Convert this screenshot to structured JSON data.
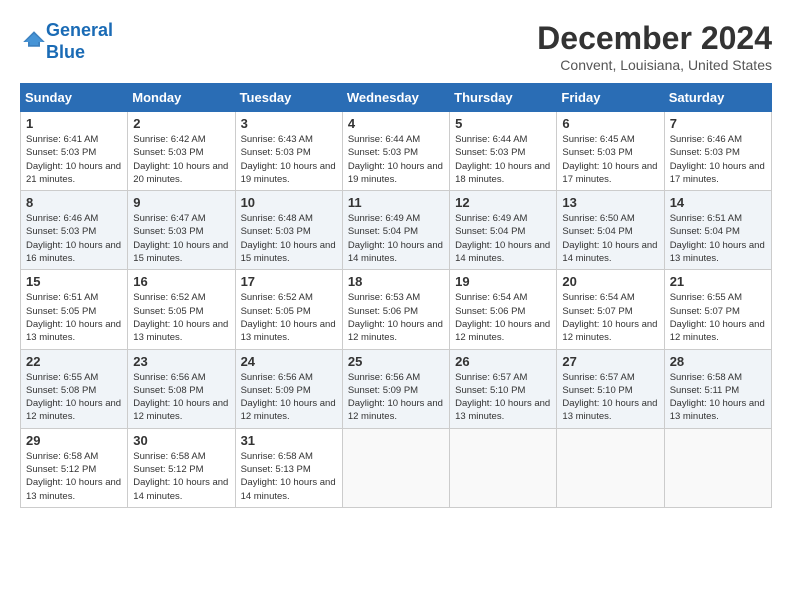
{
  "header": {
    "logo_line1": "General",
    "logo_line2": "Blue",
    "title": "December 2024",
    "location": "Convent, Louisiana, United States"
  },
  "calendar": {
    "days_of_week": [
      "Sunday",
      "Monday",
      "Tuesday",
      "Wednesday",
      "Thursday",
      "Friday",
      "Saturday"
    ],
    "weeks": [
      [
        {
          "day": "1",
          "info": "Sunrise: 6:41 AM\nSunset: 5:03 PM\nDaylight: 10 hours and 21 minutes."
        },
        {
          "day": "2",
          "info": "Sunrise: 6:42 AM\nSunset: 5:03 PM\nDaylight: 10 hours and 20 minutes."
        },
        {
          "day": "3",
          "info": "Sunrise: 6:43 AM\nSunset: 5:03 PM\nDaylight: 10 hours and 19 minutes."
        },
        {
          "day": "4",
          "info": "Sunrise: 6:44 AM\nSunset: 5:03 PM\nDaylight: 10 hours and 19 minutes."
        },
        {
          "day": "5",
          "info": "Sunrise: 6:44 AM\nSunset: 5:03 PM\nDaylight: 10 hours and 18 minutes."
        },
        {
          "day": "6",
          "info": "Sunrise: 6:45 AM\nSunset: 5:03 PM\nDaylight: 10 hours and 17 minutes."
        },
        {
          "day": "7",
          "info": "Sunrise: 6:46 AM\nSunset: 5:03 PM\nDaylight: 10 hours and 17 minutes."
        }
      ],
      [
        {
          "day": "8",
          "info": "Sunrise: 6:46 AM\nSunset: 5:03 PM\nDaylight: 10 hours and 16 minutes."
        },
        {
          "day": "9",
          "info": "Sunrise: 6:47 AM\nSunset: 5:03 PM\nDaylight: 10 hours and 15 minutes."
        },
        {
          "day": "10",
          "info": "Sunrise: 6:48 AM\nSunset: 5:03 PM\nDaylight: 10 hours and 15 minutes."
        },
        {
          "day": "11",
          "info": "Sunrise: 6:49 AM\nSunset: 5:04 PM\nDaylight: 10 hours and 14 minutes."
        },
        {
          "day": "12",
          "info": "Sunrise: 6:49 AM\nSunset: 5:04 PM\nDaylight: 10 hours and 14 minutes."
        },
        {
          "day": "13",
          "info": "Sunrise: 6:50 AM\nSunset: 5:04 PM\nDaylight: 10 hours and 14 minutes."
        },
        {
          "day": "14",
          "info": "Sunrise: 6:51 AM\nSunset: 5:04 PM\nDaylight: 10 hours and 13 minutes."
        }
      ],
      [
        {
          "day": "15",
          "info": "Sunrise: 6:51 AM\nSunset: 5:05 PM\nDaylight: 10 hours and 13 minutes."
        },
        {
          "day": "16",
          "info": "Sunrise: 6:52 AM\nSunset: 5:05 PM\nDaylight: 10 hours and 13 minutes."
        },
        {
          "day": "17",
          "info": "Sunrise: 6:52 AM\nSunset: 5:05 PM\nDaylight: 10 hours and 13 minutes."
        },
        {
          "day": "18",
          "info": "Sunrise: 6:53 AM\nSunset: 5:06 PM\nDaylight: 10 hours and 12 minutes."
        },
        {
          "day": "19",
          "info": "Sunrise: 6:54 AM\nSunset: 5:06 PM\nDaylight: 10 hours and 12 minutes."
        },
        {
          "day": "20",
          "info": "Sunrise: 6:54 AM\nSunset: 5:07 PM\nDaylight: 10 hours and 12 minutes."
        },
        {
          "day": "21",
          "info": "Sunrise: 6:55 AM\nSunset: 5:07 PM\nDaylight: 10 hours and 12 minutes."
        }
      ],
      [
        {
          "day": "22",
          "info": "Sunrise: 6:55 AM\nSunset: 5:08 PM\nDaylight: 10 hours and 12 minutes."
        },
        {
          "day": "23",
          "info": "Sunrise: 6:56 AM\nSunset: 5:08 PM\nDaylight: 10 hours and 12 minutes."
        },
        {
          "day": "24",
          "info": "Sunrise: 6:56 AM\nSunset: 5:09 PM\nDaylight: 10 hours and 12 minutes."
        },
        {
          "day": "25",
          "info": "Sunrise: 6:56 AM\nSunset: 5:09 PM\nDaylight: 10 hours and 12 minutes."
        },
        {
          "day": "26",
          "info": "Sunrise: 6:57 AM\nSunset: 5:10 PM\nDaylight: 10 hours and 13 minutes."
        },
        {
          "day": "27",
          "info": "Sunrise: 6:57 AM\nSunset: 5:10 PM\nDaylight: 10 hours and 13 minutes."
        },
        {
          "day": "28",
          "info": "Sunrise: 6:58 AM\nSunset: 5:11 PM\nDaylight: 10 hours and 13 minutes."
        }
      ],
      [
        {
          "day": "29",
          "info": "Sunrise: 6:58 AM\nSunset: 5:12 PM\nDaylight: 10 hours and 13 minutes."
        },
        {
          "day": "30",
          "info": "Sunrise: 6:58 AM\nSunset: 5:12 PM\nDaylight: 10 hours and 14 minutes."
        },
        {
          "day": "31",
          "info": "Sunrise: 6:58 AM\nSunset: 5:13 PM\nDaylight: 10 hours and 14 minutes."
        },
        {
          "day": "",
          "info": ""
        },
        {
          "day": "",
          "info": ""
        },
        {
          "day": "",
          "info": ""
        },
        {
          "day": "",
          "info": ""
        }
      ]
    ]
  }
}
